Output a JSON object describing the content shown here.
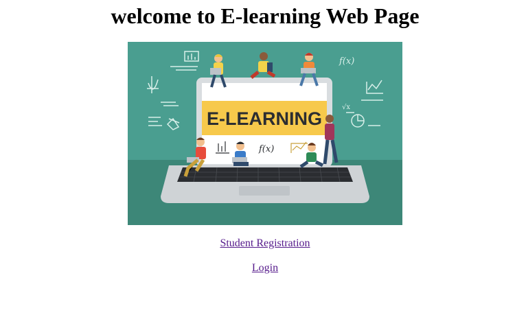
{
  "page": {
    "title": "welcome to E-learning Web Page"
  },
  "hero": {
    "banner_text": "E-LEARNING",
    "colors": {
      "background_top": "#4a9e90",
      "background_bottom": "#3d8778",
      "banner": "#f7c94b",
      "laptop_frame": "#d9dde0",
      "laptop_screen": "#ffffff",
      "keyboard": "#2b2d31"
    }
  },
  "links": {
    "student_registration": "Student Registration",
    "login": "Login",
    "link_color": "#551a8b"
  }
}
